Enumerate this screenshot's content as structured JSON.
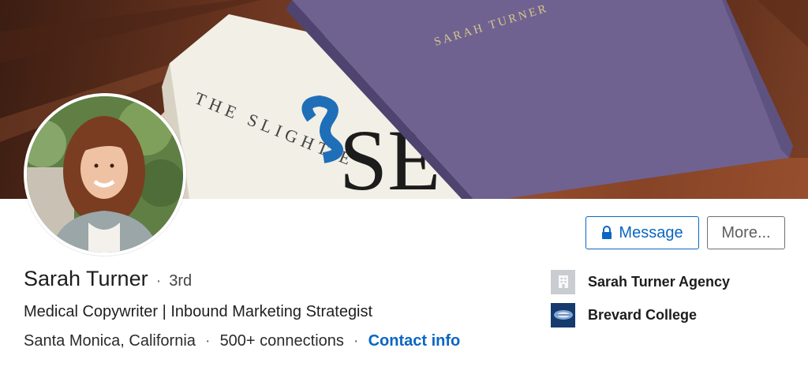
{
  "profile": {
    "name": "Sarah Turner",
    "degree_separator": "·",
    "connection_degree": "3rd",
    "headline": "Medical Copywriter | Inbound Marketing Strategist",
    "location": "Santa Monica, California",
    "connections": "500+ connections",
    "contact_info_label": "Contact info",
    "meta_separator": "·"
  },
  "actions": {
    "message_label": "Message",
    "more_label": "More..."
  },
  "side": {
    "company": {
      "label": "Sarah Turner Agency",
      "icon": "company-building-icon"
    },
    "school": {
      "label": "Brevard College",
      "icon": "college-logo-icon"
    }
  },
  "cover": {
    "book_spine_text": "SARAH TURNER",
    "book_title_fragment": "THE SLIGHT E"
  },
  "colors": {
    "link_blue": "#0a66c2",
    "book_purple": "#6f6291",
    "college_navy": "#143a6e"
  }
}
